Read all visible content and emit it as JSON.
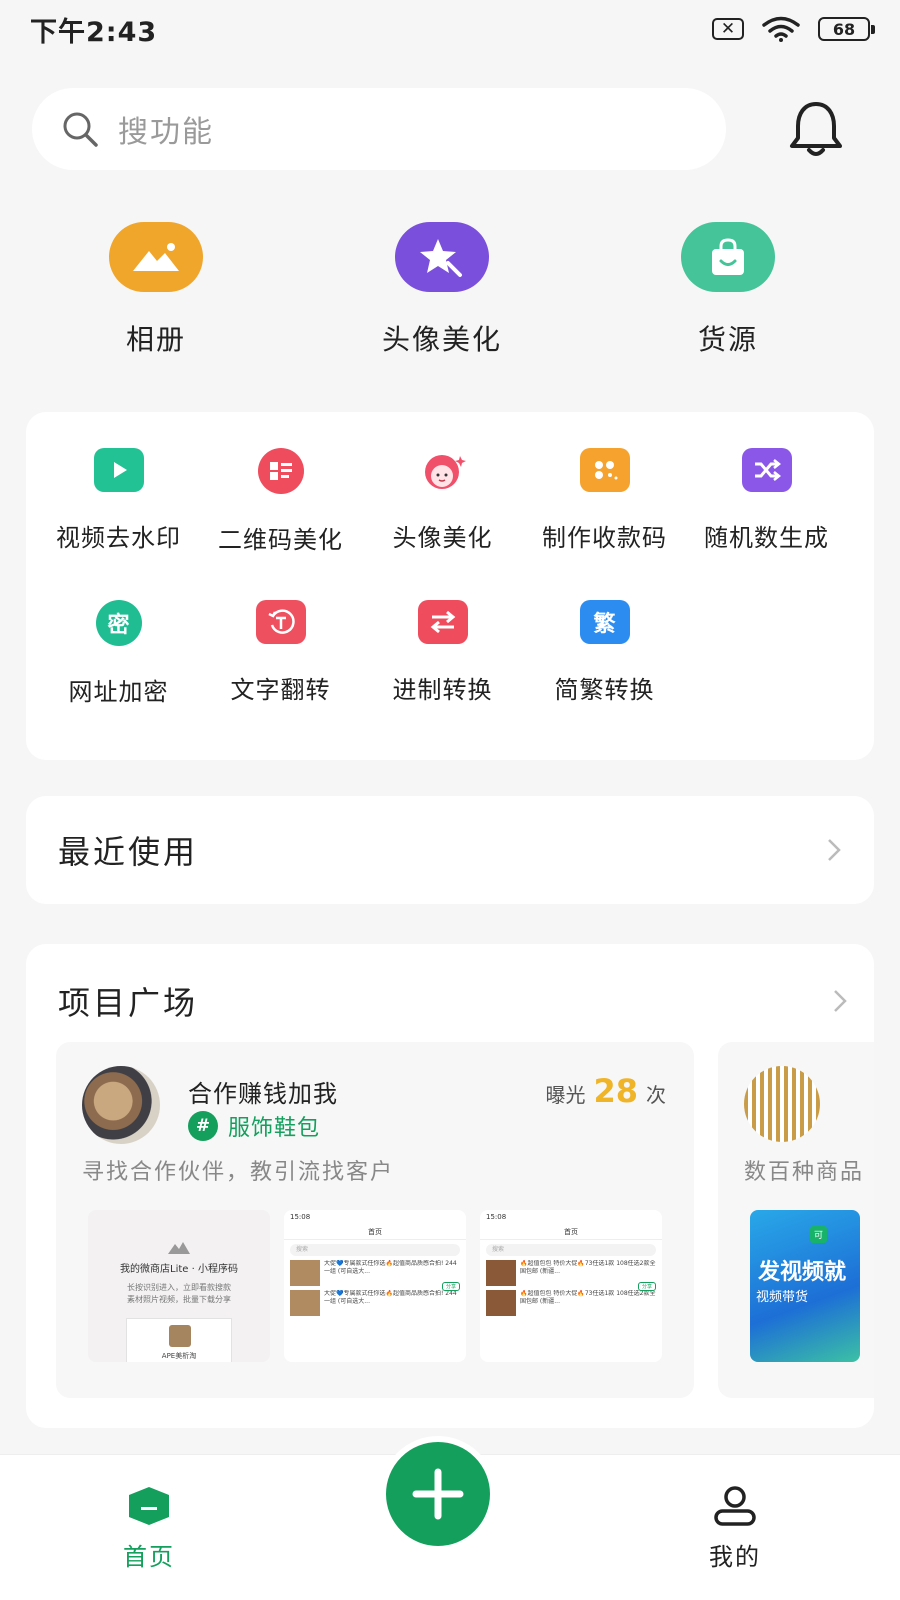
{
  "status_bar": {
    "time": "下午2:43",
    "sim_symbol": "✕",
    "battery": "68"
  },
  "search": {
    "placeholder": "搜功能"
  },
  "quick_actions": [
    {
      "label": "相册",
      "icon": "mountain-photo-icon",
      "color": "#f0a52b"
    },
    {
      "label": "头像美化",
      "icon": "star-wand-icon",
      "color": "#7a4fdb"
    },
    {
      "label": "货源",
      "icon": "shopping-bag-icon",
      "color": "#45c49a"
    }
  ],
  "tools": [
    {
      "label": "视频去水印",
      "icon": "play-icon",
      "color": "#22c294"
    },
    {
      "label": "二维码美化",
      "icon": "qr-grid-icon",
      "color": "#ef4c5d"
    },
    {
      "label": "头像美化",
      "icon": "girl-face-icon",
      "color": "#f0506a"
    },
    {
      "label": "制作收款码",
      "icon": "payment-code-icon",
      "color": "#f5a22e"
    },
    {
      "label": "随机数生成",
      "icon": "shuffle-icon",
      "color": "#8a57e8"
    },
    {
      "label": "网址加密",
      "icon": "lock-text-icon",
      "color": "#1fbd91",
      "glyph": "密"
    },
    {
      "label": "文字翻转",
      "icon": "text-rotate-icon",
      "color": "#ef5060"
    },
    {
      "label": "进制转换",
      "icon": "swap-arrows-icon",
      "color": "#ef4c5d"
    },
    {
      "label": "简繁转换",
      "icon": "traditional-char-icon",
      "color": "#2d8cf0",
      "glyph": "繁"
    }
  ],
  "recent": {
    "title": "最近使用"
  },
  "projects": {
    "title": "项目广场",
    "items": [
      {
        "title": "合作赚钱加我",
        "tag_symbol": "#",
        "tag": "服饰鞋包",
        "exposure_pre": "曝光",
        "exposure_count": "28",
        "exposure_post": "次",
        "description": "寻找合作伙伴，教引流找客户",
        "thumb1": {
          "title": "我的微商店Lite · 小程序码",
          "subtitle_1": "长按识别进入，立即看款搜款",
          "subtitle_2": "素材照片视频，批量下载分享",
          "card_name": "APE美析淘"
        },
        "thumb2": {
          "time": "15:08",
          "nav": "首页",
          "search": "搜索",
          "row1": "大促💙专属款式任你选🔥超值商品质感合拍! 244一组 (可自选大...",
          "row2": "大促💙专属款式任你选🔥超值商品质感合拍! 244一组 (可自选大...",
          "button": "分享"
        },
        "thumb3": {
          "time": "15:08",
          "nav": "首页",
          "search": "搜索",
          "row1": "🔥超值包包 特价大促🔥73任选1款 108任选2款全国包邮 (新疆...",
          "row2": "🔥超值包包 特价大促🔥73任选1款 108任选2款全国包邮 (新疆...",
          "button": "分享"
        }
      },
      {
        "description": "数百种商品",
        "banner_badge": "可",
        "banner_big": "发视频就",
        "banner_small": "视频带货"
      }
    ]
  },
  "bottom_nav": {
    "home": "首页",
    "mine": "我的",
    "active_color": "#14a05c"
  }
}
